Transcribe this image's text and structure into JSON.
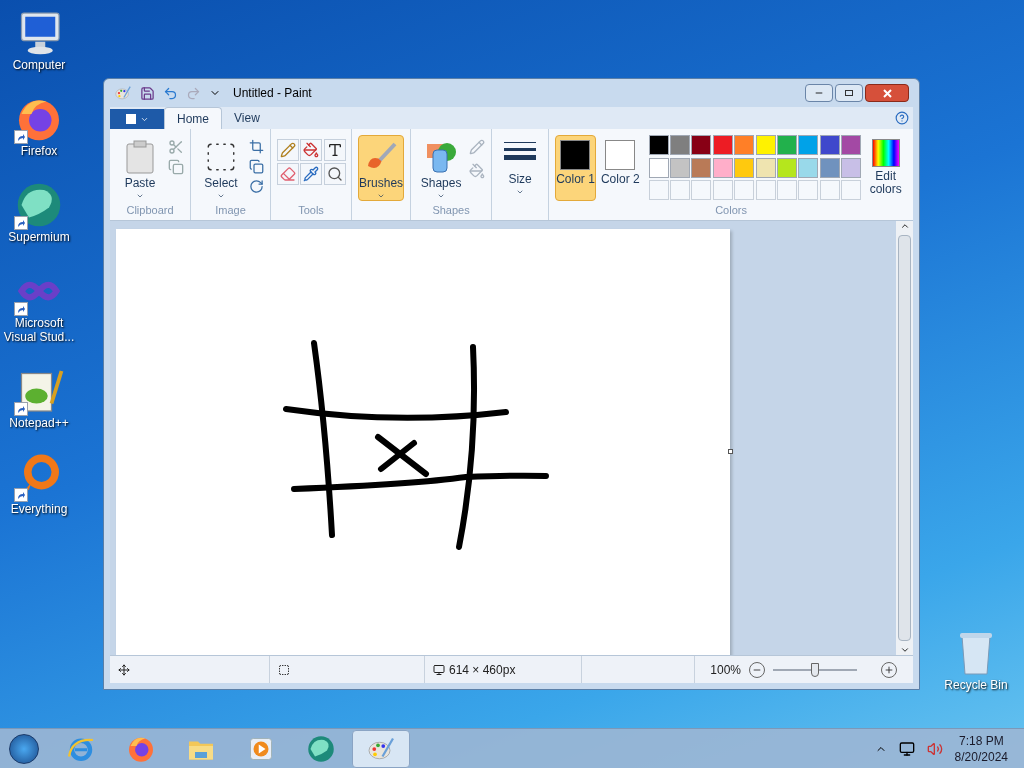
{
  "desktop_icons": [
    {
      "kind": "computer",
      "label": "Computer",
      "shortcut": false
    },
    {
      "kind": "firefox",
      "label": "Firefox",
      "shortcut": true
    },
    {
      "kind": "supermium",
      "label": "Supermium",
      "shortcut": true
    },
    {
      "kind": "vs",
      "label": "Microsoft Visual Stud...",
      "shortcut": true
    },
    {
      "kind": "notepad",
      "label": "Notepad++",
      "shortcut": true
    },
    {
      "kind": "everything",
      "label": "Everything",
      "shortcut": true
    }
  ],
  "recycle_bin": {
    "label": "Recycle Bin"
  },
  "window": {
    "title": "Untitled - Paint",
    "tabs": [
      {
        "label": "Home",
        "selected": true
      },
      {
        "label": "View",
        "selected": false
      }
    ],
    "ribbon": {
      "groups": [
        {
          "kind": "clipboard",
          "label": "Clipboard",
          "button": "Paste"
        },
        {
          "kind": "image",
          "label": "Image",
          "button": "Select"
        },
        {
          "kind": "tools",
          "label": "Tools"
        },
        {
          "kind": "brushes",
          "button": "Brushes",
          "selected": true
        },
        {
          "kind": "shapes",
          "label": "Shapes",
          "button": "Shapes"
        },
        {
          "kind": "size",
          "button": "Size"
        }
      ],
      "colors": {
        "label": "Colors",
        "color1": {
          "label": "Color 1",
          "color": "#000000",
          "selected": true
        },
        "color2": {
          "label": "Color 2",
          "color": "#ffffff",
          "selected": false
        },
        "palette": [
          {
            "color": "#000000"
          },
          {
            "color": "#7f7f7f"
          },
          {
            "color": "#880015"
          },
          {
            "color": "#ed1c24"
          },
          {
            "color": "#ff7f27"
          },
          {
            "color": "#fff200"
          },
          {
            "color": "#22b14c"
          },
          {
            "color": "#00a2e8"
          },
          {
            "color": "#3f48cc"
          },
          {
            "color": "#a349a4"
          },
          {
            "color": "#ffffff"
          },
          {
            "color": "#c3c3c3"
          },
          {
            "color": "#b97a57"
          },
          {
            "color": "#ffaec9"
          },
          {
            "color": "#ffc90e"
          },
          {
            "color": "#efe4b0"
          },
          {
            "color": "#b5e61d"
          },
          {
            "color": "#99d9ea"
          },
          {
            "color": "#7092be"
          },
          {
            "color": "#c8bfe7"
          }
        ],
        "edit_colors": "Edit colors"
      }
    },
    "status_bar": {
      "dimensions": "614 × 460px",
      "zoom": "100%",
      "zoom_slider": {
        "level": 0.5
      }
    }
  },
  "taskbar": {
    "apps": [
      {
        "kind": "ie",
        "selected": false
      },
      {
        "kind": "firefox",
        "selected": false
      },
      {
        "kind": "explorer",
        "selected": false
      },
      {
        "kind": "media",
        "selected": false
      },
      {
        "kind": "supermium",
        "selected": false
      },
      {
        "kind": "paint",
        "selected": true
      }
    ],
    "time": "7:18 PM",
    "date": "8/20/2024"
  }
}
